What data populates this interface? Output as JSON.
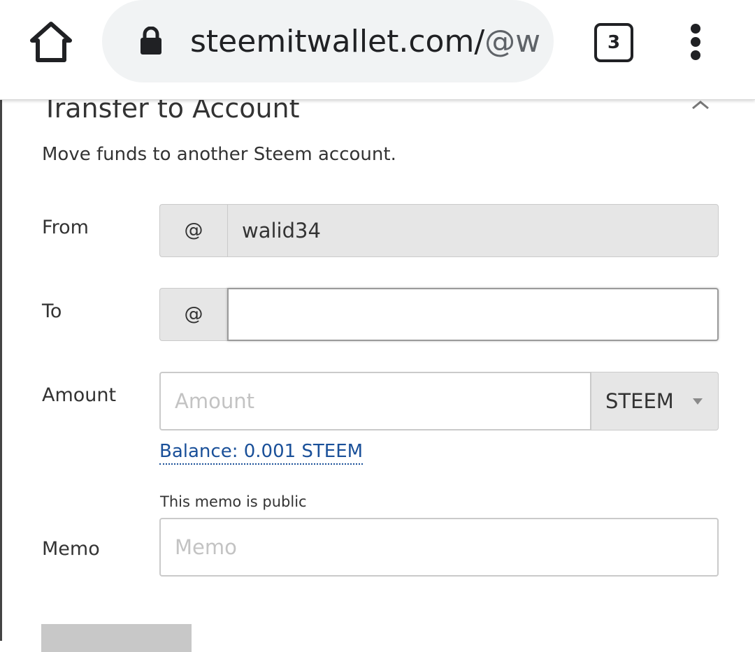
{
  "browser": {
    "url_main": "steemitwallet.com/",
    "url_muted": "@w",
    "tab_count": "3"
  },
  "dialog": {
    "title": "Transfer to Account",
    "subtitle": "Move funds to another Steem account."
  },
  "form": {
    "from_label": "From",
    "from_prefix": "@",
    "from_value": "walid34",
    "to_label": "To",
    "to_prefix": "@",
    "to_value": "",
    "amount_label": "Amount",
    "amount_placeholder": "Amount",
    "asset_selected": "STEEM",
    "balance_text": "Balance: 0.001 STEEM",
    "memo_note": "This memo is public",
    "memo_label": "Memo",
    "memo_placeholder": "Memo"
  },
  "colors": {
    "link": "#1a5099",
    "addon_bg": "#e6e6e6",
    "url_pill_bg": "#f1f3f4"
  },
  "icons": {
    "home": "home-icon",
    "lock": "lock-icon",
    "menu": "more-vert-icon",
    "close": "chevron-up-icon",
    "asset_caret": "caret-down-icon"
  }
}
